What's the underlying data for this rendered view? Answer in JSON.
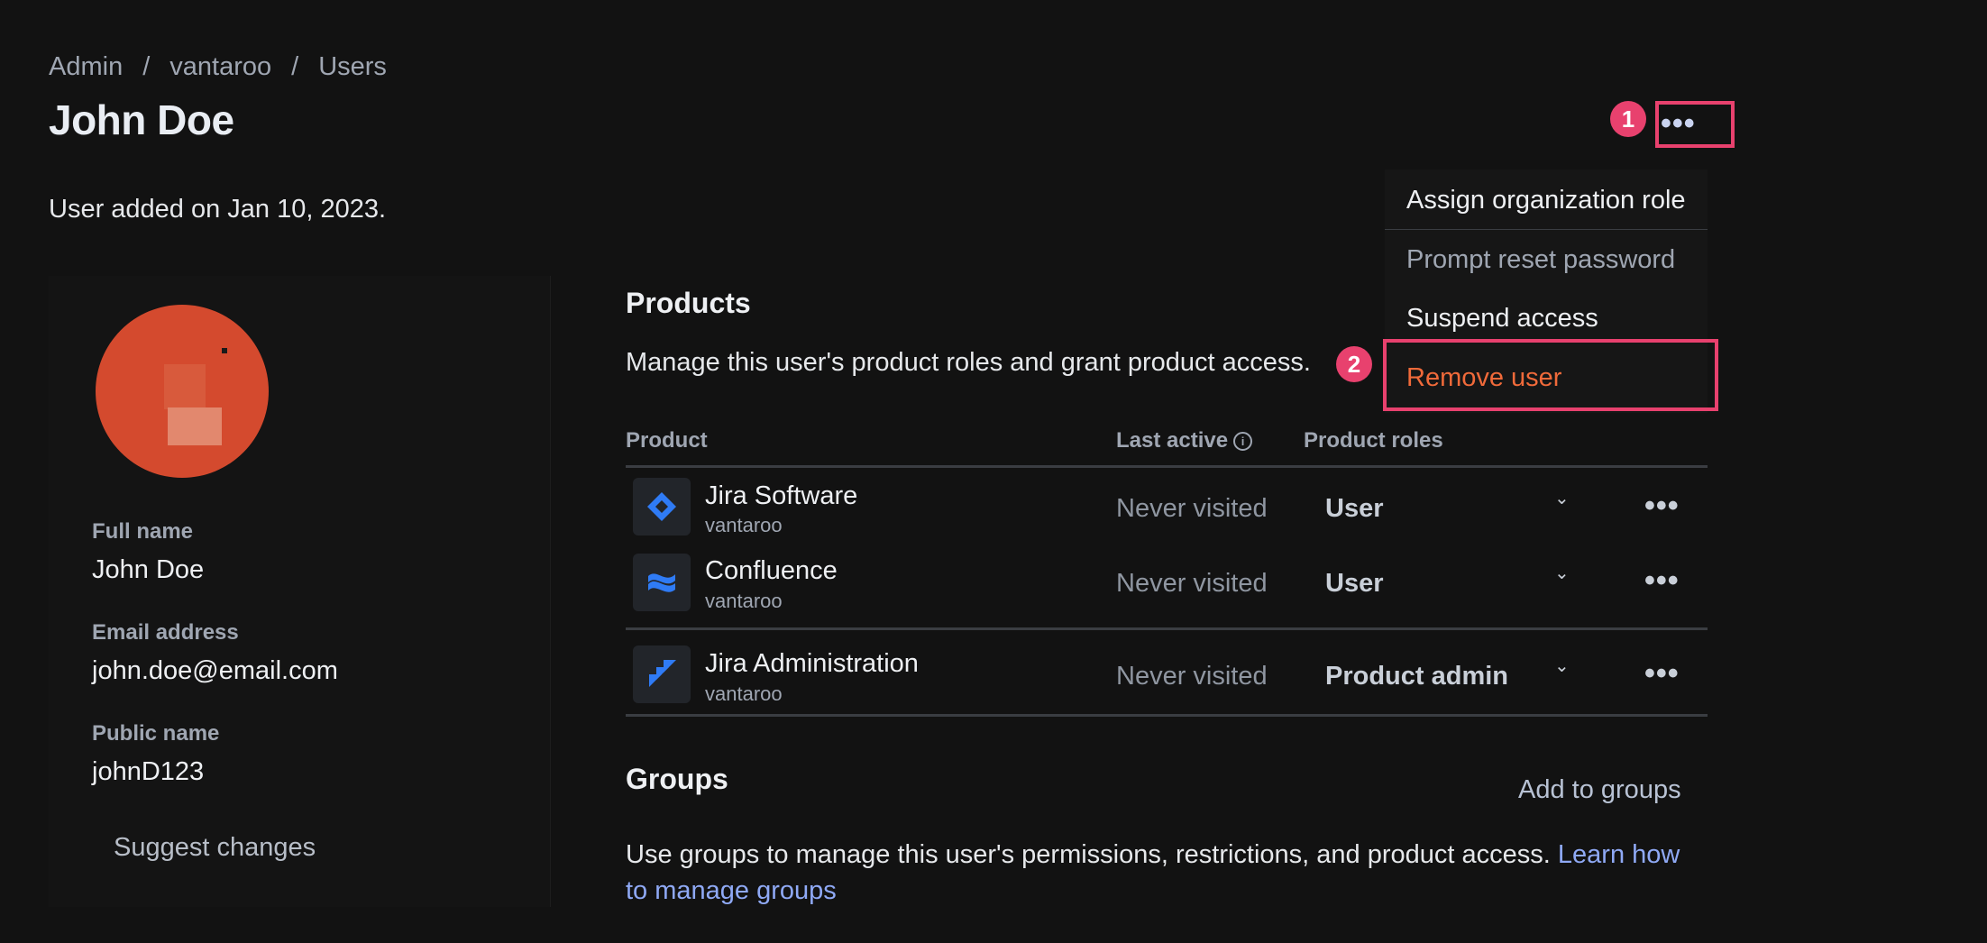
{
  "breadcrumb": {
    "items": [
      "Admin",
      "vantaroo",
      "Users"
    ],
    "separator": "/"
  },
  "page_title": "John Doe",
  "added_note": "User added on Jan 10, 2023.",
  "profile": {
    "fields": [
      {
        "label": "Full name",
        "value": "John Doe"
      },
      {
        "label": "Email address",
        "value": "john.doe@email.com"
      },
      {
        "label": "Public name",
        "value": "johnD123"
      }
    ],
    "suggest_label": "Suggest changes"
  },
  "products": {
    "title": "Products",
    "description": "Manage this user's product roles and grant product access.",
    "columns": {
      "product": "Product",
      "last_active": "Last active",
      "roles": "Product roles"
    },
    "rows": [
      {
        "name": "Jira Software",
        "site": "vantaroo",
        "last_active": "Never visited",
        "role": "User",
        "icon": "jira-software-icon"
      },
      {
        "name": "Confluence",
        "site": "vantaroo",
        "last_active": "Never visited",
        "role": "User",
        "icon": "confluence-icon"
      },
      {
        "name": "Jira Administration",
        "site": "vantaroo",
        "last_active": "Never visited",
        "role": "Product admin",
        "icon": "jira-admin-icon"
      }
    ]
  },
  "groups": {
    "title": "Groups",
    "add_label": "Add to groups",
    "description": "Use groups to manage this user's permissions, restrictions, and product access.",
    "link_line1": "Learn how",
    "link_line2": "to manage groups"
  },
  "menu": {
    "items": [
      "Assign organization role",
      "Prompt reset password",
      "Suspend access",
      "Remove user"
    ]
  },
  "annotations": {
    "badge1": "1",
    "badge2": "2"
  },
  "more_glyph": "•••",
  "chevron_glyph": "⌄",
  "info_glyph": "i",
  "colors": {
    "background": "#121212",
    "accent_highlight": "#e8416e",
    "danger_text": "#f06a3a",
    "link": "#8fa9f5",
    "avatar": "#d44a2e",
    "product_icon": "#2f7bf5"
  }
}
